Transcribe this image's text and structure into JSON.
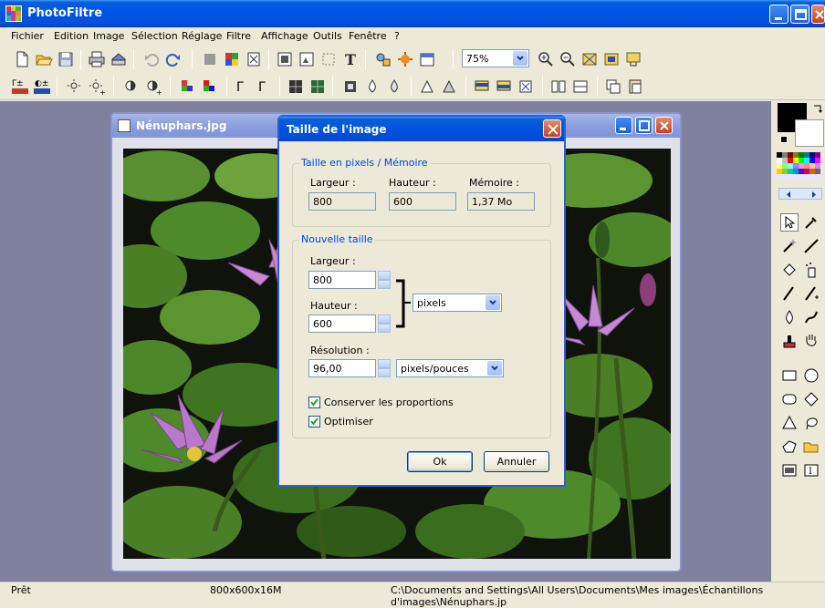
{
  "app": {
    "title": "PhotoFiltre"
  },
  "menu": [
    "Fichier",
    "Edition",
    "Image",
    "Sélection",
    "Réglage",
    "Filtre",
    "Affichage",
    "Outils",
    "Fenêtre",
    "?"
  ],
  "toolbar": {
    "zoom": "75%"
  },
  "image_window": {
    "title": "Nénuphars.jpg"
  },
  "dialog": {
    "title": "Taille de l'image",
    "memory_group": {
      "label": "Taille en pixels / Mémoire",
      "width_label": "Largeur :",
      "height_label": "Hauteur :",
      "memory_label": "Mémoire :",
      "width_value": "800",
      "height_value": "600",
      "memory_value": "1,37 Mo"
    },
    "new_size_group": {
      "label": "Nouvelle taille",
      "width_label": "Largeur :",
      "width_value": "800",
      "height_label": "Hauteur :",
      "height_value": "600",
      "unit": "pixels",
      "resolution_label": "Résolution :",
      "resolution_value": "96,00",
      "resolution_unit": "pixels/pouces",
      "keep_proportions": "Conserver les proportions",
      "optimize": "Optimiser"
    },
    "ok": "Ok",
    "cancel": "Annuler"
  },
  "status": {
    "state": "Prêt",
    "info": "800x600x16M",
    "path": "C:\\Documents and Settings\\All Users\\Documents\\Mes images\\Échantillons d'images\\Nénuphars.jp"
  },
  "colors": {
    "titlebar": "#0054e3",
    "workspace": "#7f7f9e",
    "dialog_bg": "#ece9d8",
    "accent_text": "#0046d5"
  }
}
